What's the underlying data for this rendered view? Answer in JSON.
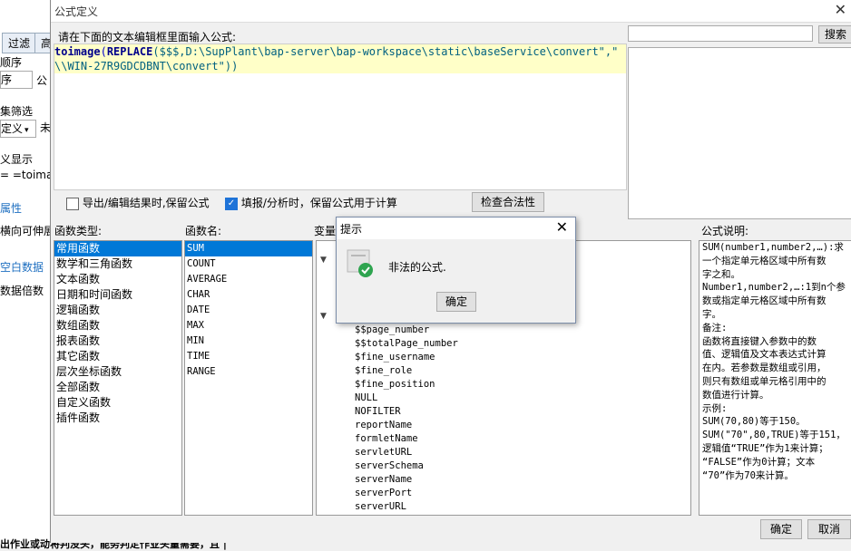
{
  "background": {
    "tab_filter": "过滤",
    "tab_partial": "高",
    "order_label": "顺序",
    "order_select": "序",
    "formula_short": "公",
    "filter_label": "集筛选",
    "define_select": "定义",
    "not_short": "未",
    "display_label": "义显示",
    "equals_formula": "= =toima",
    "property_link": "属性",
    "expand_label": "横向可伸展",
    "blank_data": "空白数据",
    "data_multiple": "数据倍数",
    "bottom_text": "出作业或动将判没头，能务判定作业头量需要，且 |"
  },
  "dialog": {
    "title": "公式定义",
    "prompt": "请在下面的文本编辑框里面输入公式:",
    "formula_line1_func": "toimage",
    "formula_line1_open": "(",
    "formula_line1_replace": "REPLACE",
    "formula_line1_rest": "($$$,D:\\SupPlant\\bap-server\\bap-workspace\\static\\baseService\\convert\",\"",
    "formula_line2": "\\\\WIN-27R9GDCDBNT\\convert\"))",
    "search_placeholder": "",
    "search_button": "搜索",
    "keep_formula_export": "导出/编辑结果时,保留公式",
    "keep_formula_calc": "填报/分析时，保留公式用于计算",
    "check_validity": "检查合法性",
    "func_type_label": "函数类型:",
    "func_name_label": "函数名:",
    "variable_label": "变量",
    "desc_label": "公式说明:",
    "ok": "确定",
    "cancel": "取消"
  },
  "function_types": [
    "常用函数",
    "数学和三角函数",
    "文本函数",
    "日期和时间函数",
    "逻辑函数",
    "数组函数",
    "报表函数",
    "其它函数",
    "层次坐标函数",
    "全部函数",
    "自定义函数",
    "插件函数"
  ],
  "function_names": [
    "SUM",
    "COUNT",
    "AVERAGE",
    "CHAR",
    "DATE",
    "MAX",
    "MIN",
    "TIME",
    "RANGE"
  ],
  "variables": [
    "$$page_number",
    "$$totalPage_number",
    "$fine_username",
    "$fine_role",
    "$fine_position",
    "NULL",
    "NOFILTER",
    "reportName",
    "formletName",
    "servletURL",
    "serverSchema",
    "serverName",
    "serverPort",
    "serverURL"
  ],
  "description": [
    "SUM(number1,number2,…):求",
    "一个指定单元格区域中所有数",
    "字之和。",
    "Number1,number2,…:1到n个参",
    "数或指定单元格区域中所有数",
    "字。",
    "备注:",
    "函数将直接键入参数中的数",
    "值、逻辑值及文本表达式计算",
    "在内。若参数是数组或引用，",
    "则只有数组或单元格引用中的",
    "数值进行计算。",
    "示例:",
    "SUM(70,80)等于150。",
    "SUM(\"70\",80,TRUE)等于151，",
    "逻辑值“TRUE”作为1来计算；",
    "“FALSE”作为0计算；文本",
    "“70”作为70来计算。"
  ],
  "popup": {
    "title": "提示",
    "message": "非法的公式.",
    "ok": "确定"
  },
  "colors": {
    "selection": "#0078d7",
    "highlight_line": "#ffffc8",
    "check_ok": "#2ea44f"
  }
}
